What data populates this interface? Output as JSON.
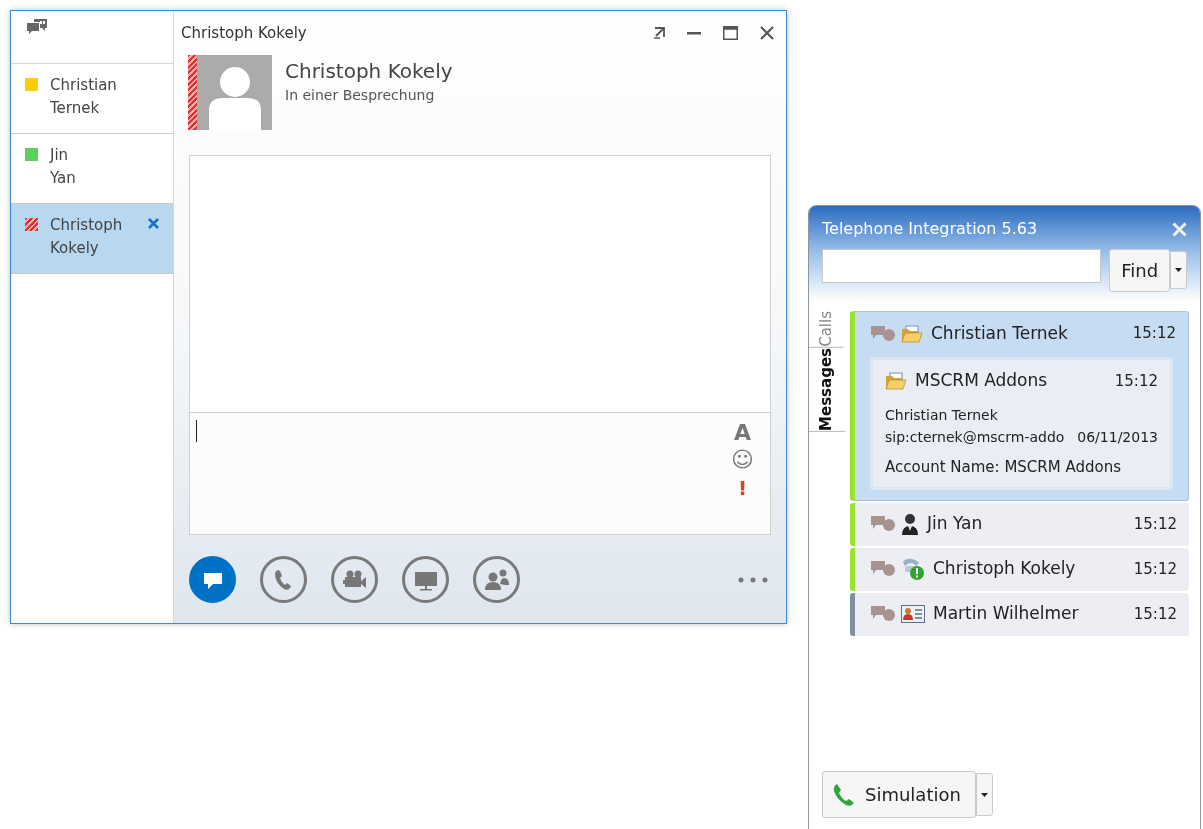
{
  "conversation_window": {
    "contacts": [
      {
        "lines": [
          "Christian",
          "Ternek"
        ],
        "color": "#ffcc00",
        "kind": "solid",
        "selected": false
      },
      {
        "lines": [
          "Jin",
          "Yan"
        ],
        "color": "#5bd15b",
        "kind": "solid",
        "selected": false
      },
      {
        "lines": [
          "Christoph",
          "Kokely"
        ],
        "color": "#e03030",
        "kind": "striped",
        "selected": true
      }
    ],
    "title": "Christoph Kokely",
    "contact": {
      "name": "Christoph Kokely",
      "status": "In einer Besprechung"
    },
    "compose_tools": [
      {
        "kind": "font",
        "text": "A"
      },
      {
        "kind": "emoticon",
        "text": "☺"
      },
      {
        "kind": "priority",
        "text": "!"
      }
    ],
    "actions": [
      {
        "kind": "im",
        "selected": true
      },
      {
        "kind": "call",
        "selected": false
      },
      {
        "kind": "video",
        "selected": false
      },
      {
        "kind": "screen",
        "selected": false
      },
      {
        "kind": "people",
        "selected": false
      }
    ]
  },
  "telephone_window": {
    "title": "Telephone Integration 5.63",
    "find_button": "Find",
    "tabs": [
      {
        "label": "Calls",
        "selected": false
      },
      {
        "label": "Messages",
        "selected": true
      }
    ],
    "entries": [
      {
        "kind": "folder",
        "name": "Christian Ternek",
        "time": "15:12",
        "color": "#9be22e",
        "expanded": true,
        "detail": {
          "title": "MSCRM Addons",
          "time": "15:12",
          "contact": "Christian Ternek",
          "address": "sip:cternek@mscrm-addo",
          "date": "06/11/2013",
          "account": "Account Name: MSCRM Addons"
        }
      },
      {
        "kind": "person",
        "name": "Jin Yan",
        "time": "15:12",
        "color": "#9be22e",
        "expanded": false
      },
      {
        "kind": "phone-alert",
        "name": "Christoph Kokely",
        "time": "15:12",
        "color": "#9be22e",
        "expanded": false
      },
      {
        "kind": "contact-card",
        "name": "Martin Wilhelmer",
        "time": "15:12",
        "color": "#7f8fa0",
        "expanded": false
      }
    ],
    "simulation_button": "Simulation"
  }
}
